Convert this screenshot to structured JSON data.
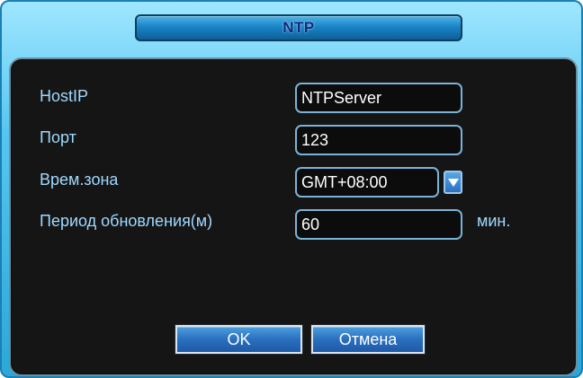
{
  "dialog": {
    "title": "NTP"
  },
  "form": {
    "host_label": "HostIP",
    "host_value": "NTPServer",
    "port_label": "Порт",
    "port_value": "123",
    "timezone_label": "Врем.зона",
    "timezone_value": "GMT+08:00",
    "update_period_label": "Период обновления(м)",
    "update_period_value": "60",
    "update_period_unit": "мин."
  },
  "buttons": {
    "ok_label": "OK",
    "cancel_label": "Отмена"
  },
  "icons": {
    "dropdown": "chevron-down-icon"
  },
  "colors": {
    "label": "#9fd9ff",
    "title": "#0b2a7a",
    "panel_bg": "#151515",
    "frame": "#56c6f0",
    "button": "#2a6fbf"
  }
}
